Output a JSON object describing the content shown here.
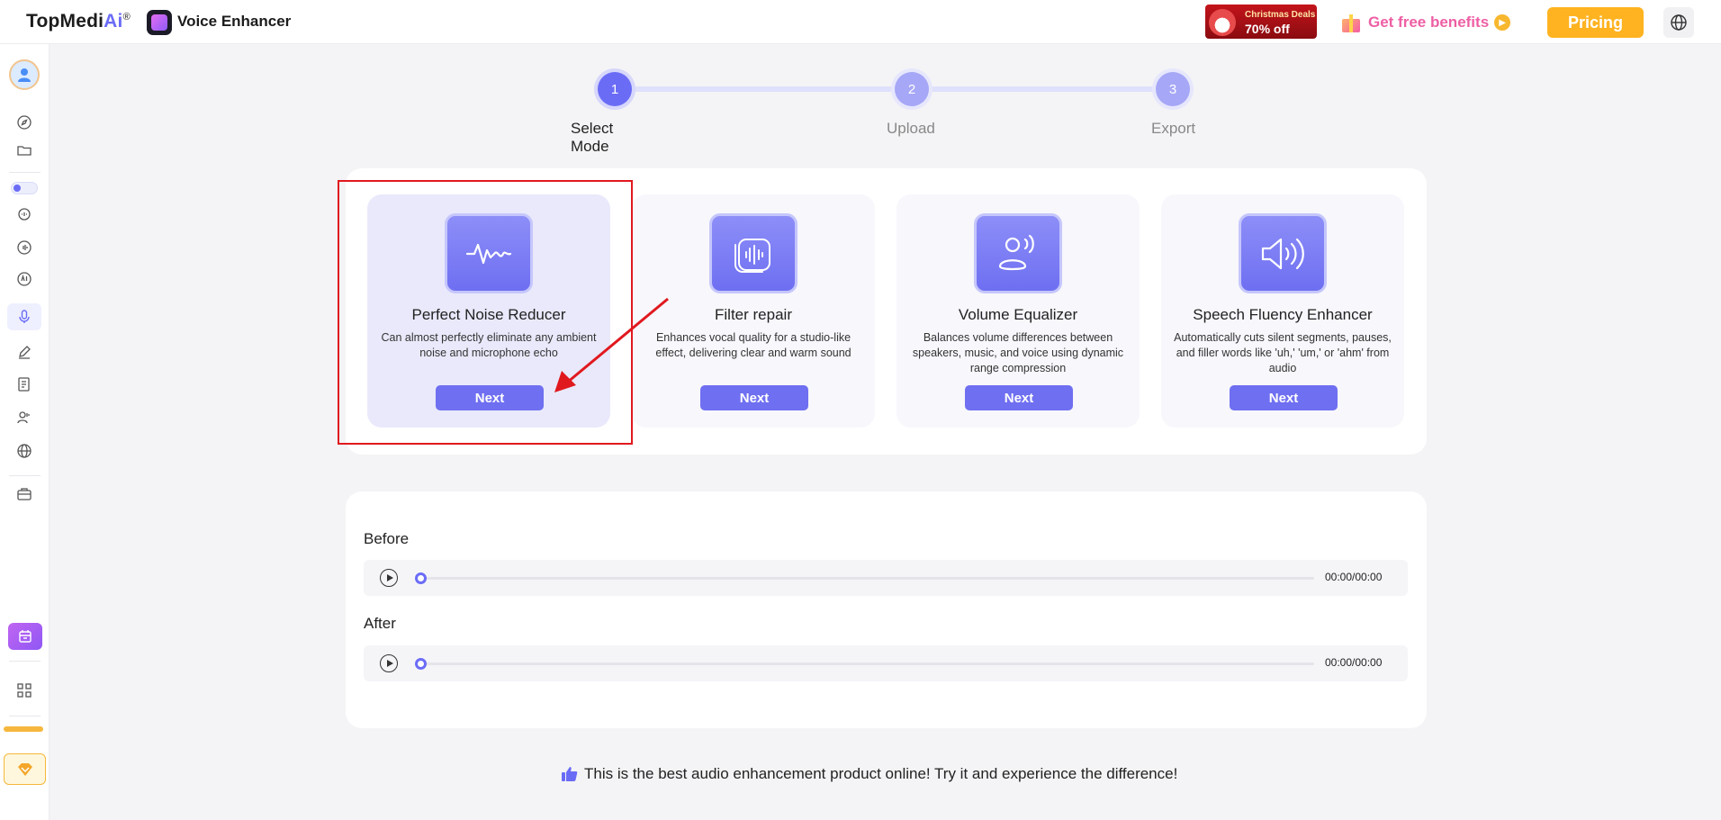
{
  "header": {
    "brand_main": "TopMedi",
    "brand_ai": "Ai",
    "brand_reg": "®",
    "app_name": "Voice Enhancer",
    "promo_line1": "Christmas Deals",
    "promo_line2": "70% off",
    "benefits_label": "Get free benefits",
    "pricing_label": "Pricing",
    "globe_icon": "globe-icon"
  },
  "colors": {
    "accent": "#6b6cf6",
    "pricing": "#ffb321",
    "benefits": "#ee5fa5",
    "highlight_border": "#e0191f"
  },
  "sidebar": {
    "items": [
      {
        "icon": "avatar-icon"
      },
      {
        "icon": "compass-icon"
      },
      {
        "icon": "folder-icon"
      },
      {
        "icon": "toggle-icon"
      },
      {
        "icon": "voice-chat-icon"
      },
      {
        "icon": "waveform-icon"
      },
      {
        "icon": "ai-voice-icon"
      },
      {
        "icon": "microphone-icon",
        "active": true
      },
      {
        "icon": "pen-icon"
      },
      {
        "icon": "document-icon"
      },
      {
        "icon": "users-icon"
      },
      {
        "icon": "globe-icon"
      },
      {
        "icon": "toolbox-icon"
      },
      {
        "icon": "calendar-icon"
      },
      {
        "icon": "grid-icon"
      },
      {
        "icon": "diamond-icon"
      }
    ]
  },
  "steps": [
    {
      "number": "1",
      "label": "Select Mode",
      "active": true
    },
    {
      "number": "2",
      "label": "Upload",
      "active": false
    },
    {
      "number": "3",
      "label": "Export",
      "active": false
    }
  ],
  "modes": [
    {
      "title": "Perfect Noise Reducer",
      "description": "Can almost perfectly eliminate any ambient noise and microphone echo",
      "button": "Next",
      "icon": "waveform-pulse-icon",
      "selected": true
    },
    {
      "title": "Filter repair",
      "description": "Enhances vocal quality for a studio-like effect, delivering clear and warm sound",
      "button": "Next",
      "icon": "layered-wave-icon",
      "selected": false
    },
    {
      "title": "Volume Equalizer",
      "description": "Balances volume differences between speakers, music, and voice using dynamic range compression",
      "button": "Next",
      "icon": "speaker-person-icon",
      "selected": false
    },
    {
      "title": "Speech Fluency Enhancer",
      "description": "Automatically cuts silent segments, pauses, and filler words like 'uh,' 'um,' or 'ahm' from audio",
      "button": "Next",
      "icon": "volume-icon",
      "selected": false
    }
  ],
  "audio": {
    "before_label": "Before",
    "after_label": "After",
    "before_time": "00:00/00:00",
    "after_time": "00:00/00:00"
  },
  "footer": {
    "message": "This is the best audio enhancement product online! Try it and experience the difference!",
    "icon": "thumbs-up-icon"
  }
}
